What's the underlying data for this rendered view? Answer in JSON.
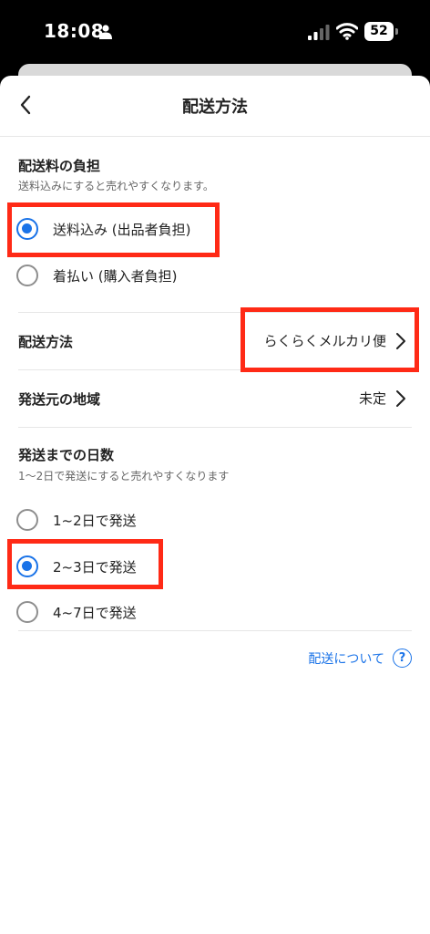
{
  "status_bar": {
    "time": "18:08",
    "battery": "52"
  },
  "header": {
    "title": "配送方法"
  },
  "shipping_fee": {
    "title": "配送料の負担",
    "hint": "送料込みにすると売れやすくなります。",
    "options": [
      {
        "label": "送料込み (出品者負担)",
        "selected": true
      },
      {
        "label": "着払い (購入者負担)",
        "selected": false
      }
    ]
  },
  "shipping_method": {
    "label": "配送方法",
    "value": "らくらくメルカリ便"
  },
  "origin_region": {
    "label": "発送元の地域",
    "value": "未定"
  },
  "days_to_ship": {
    "title": "発送までの日数",
    "hint": "1〜2日で発送にすると売れやすくなります",
    "options": [
      {
        "label": "1~2日で発送",
        "selected": false
      },
      {
        "label": "2~3日で発送",
        "selected": true
      },
      {
        "label": "4~7日で発送",
        "selected": false
      }
    ]
  },
  "about_shipping_link": "配送について",
  "help_icon_glyph": "?",
  "colors": {
    "accent": "#1a73e8",
    "highlight": "#ff2a16"
  }
}
